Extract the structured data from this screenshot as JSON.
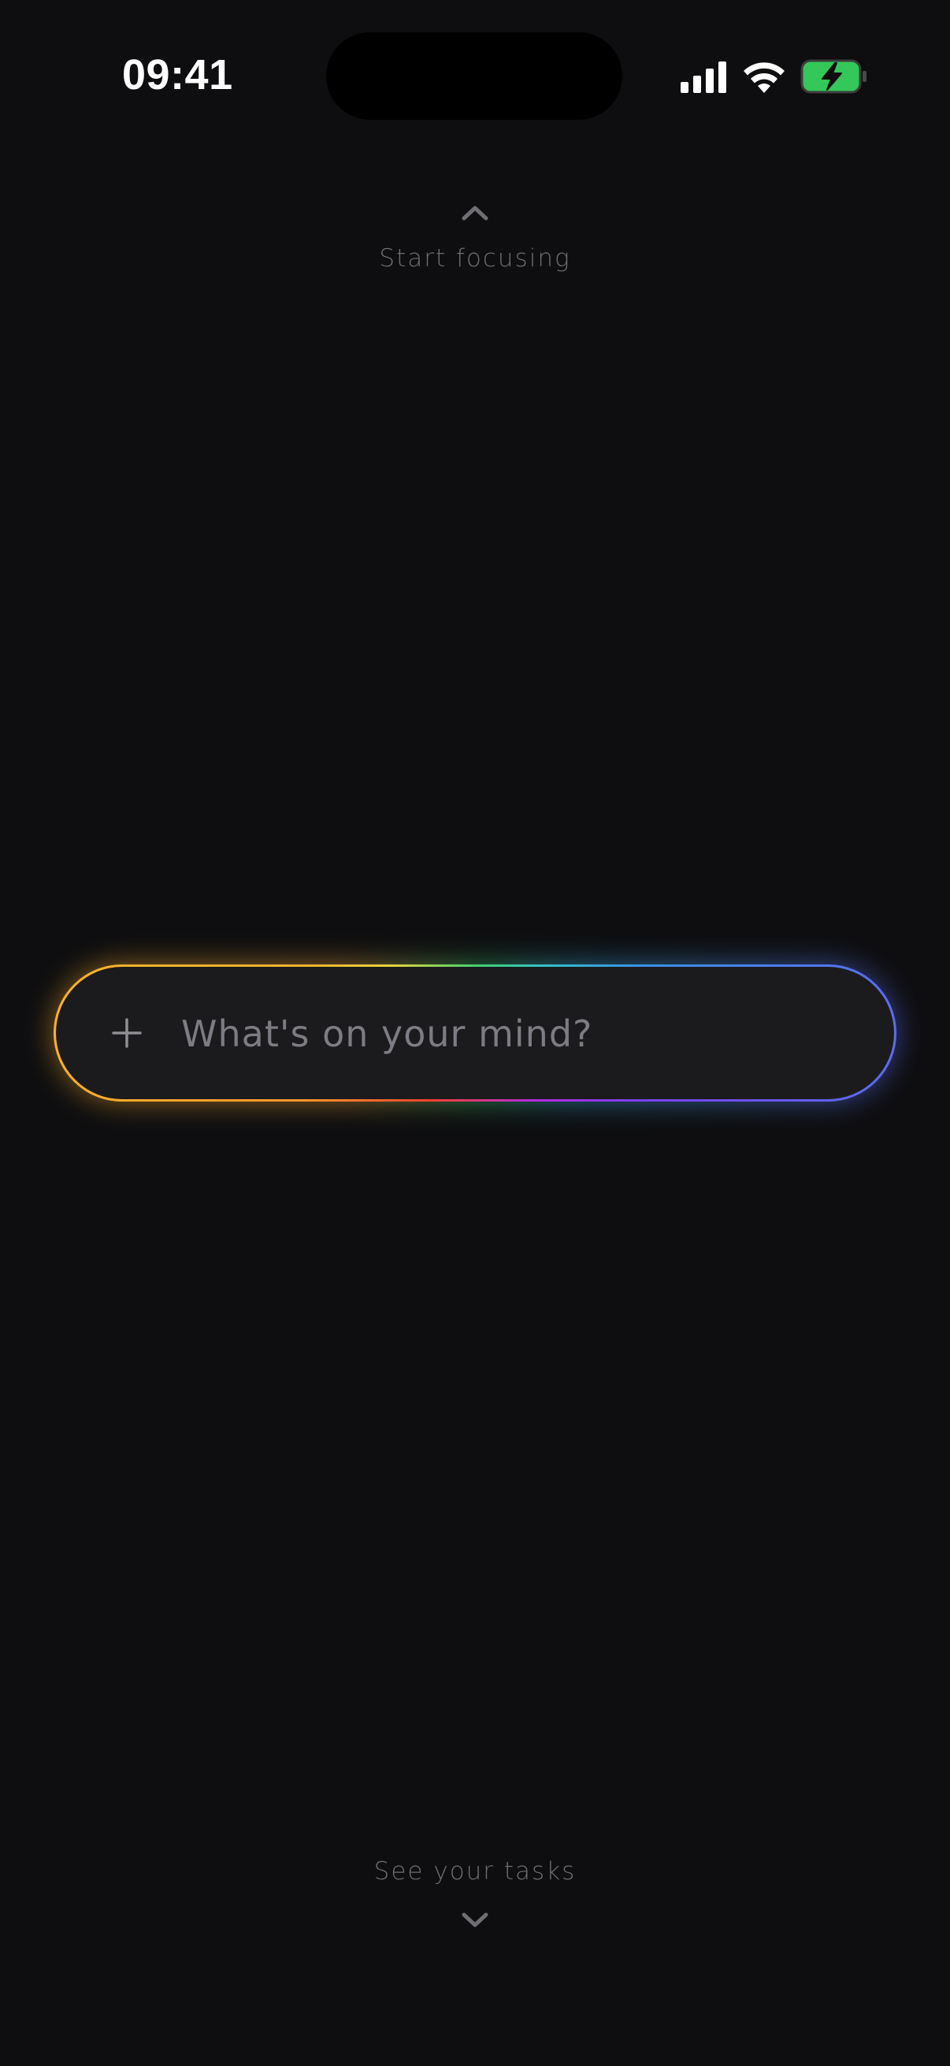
{
  "status_bar": {
    "time": "09:41",
    "icons": [
      "signal-icon",
      "wifi-icon",
      "battery-charging-icon"
    ]
  },
  "top_hint": {
    "icon": "chevron-up-icon",
    "label": "Start focusing"
  },
  "composer": {
    "icon": "plus-icon",
    "placeholder": "What's on your mind?",
    "value": ""
  },
  "bottom_hint": {
    "label": "See your tasks",
    "icon": "chevron-down-icon"
  },
  "colors": {
    "background": "#0e0e10",
    "pill_fill": "#1b1b1e",
    "hint_text": "#6e6e73",
    "battery_green": "#34c759",
    "gradient_warm": "#f9b12a",
    "gradient_cool": "#5a6cf2"
  }
}
